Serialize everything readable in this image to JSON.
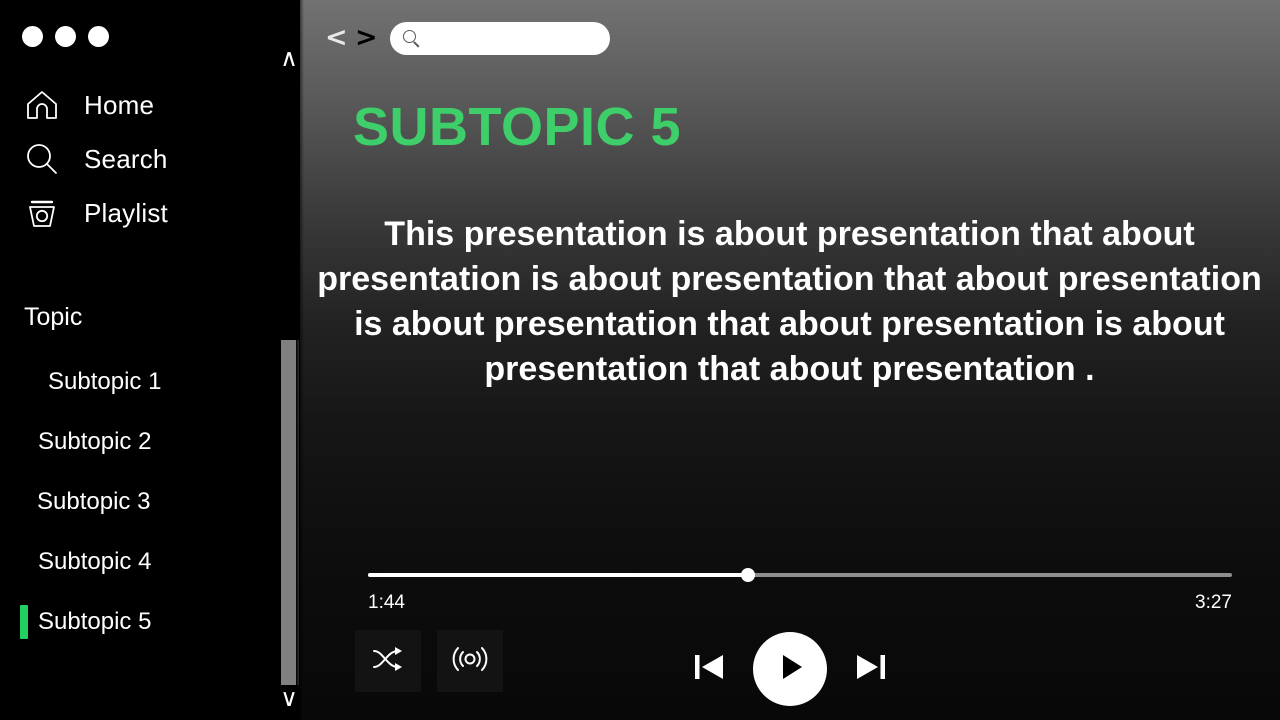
{
  "window": {
    "dots_count": 3,
    "dot_color": "#ffffff"
  },
  "sidebar": {
    "nav": [
      {
        "label": "Home",
        "icon": "home-icon"
      },
      {
        "label": "Search",
        "icon": "search-icon"
      },
      {
        "label": "Playlist",
        "icon": "playlist-icon"
      }
    ],
    "topic_header": "Topic",
    "subtopics": [
      {
        "label": "Subtopic 1",
        "active": false
      },
      {
        "label": "Subtopic 2",
        "active": false
      },
      {
        "label": "Subtopic 3",
        "active": false
      },
      {
        "label": "Subtopic 4",
        "active": false
      },
      {
        "label": "Subtopic 5",
        "active": true
      }
    ],
    "active_marker_color": "#21d060",
    "scroll_up_icon": "∧",
    "scroll_down_icon": "∨",
    "scrollbar_thumb_color": "#808080"
  },
  "topbar": {
    "back_label": "<",
    "forward_label": ">",
    "search": {
      "value": "",
      "placeholder": ""
    }
  },
  "content": {
    "title": "SUBTOPIC 5",
    "title_color": "#3ecf6a",
    "paragraph": "This presentation is about presentation that about presentation is about presentation that about presentation is about presentation that about presentation is about presentation that about presentation ."
  },
  "player": {
    "current_time": "1:44",
    "total_time": "3:27",
    "progress_percent": 44,
    "shuffle_icon": "shuffle-icon",
    "broadcast_icon": "broadcast-icon",
    "previous_icon": "previous-track-icon",
    "play_icon": "play-icon",
    "next_icon": "next-track-icon"
  }
}
